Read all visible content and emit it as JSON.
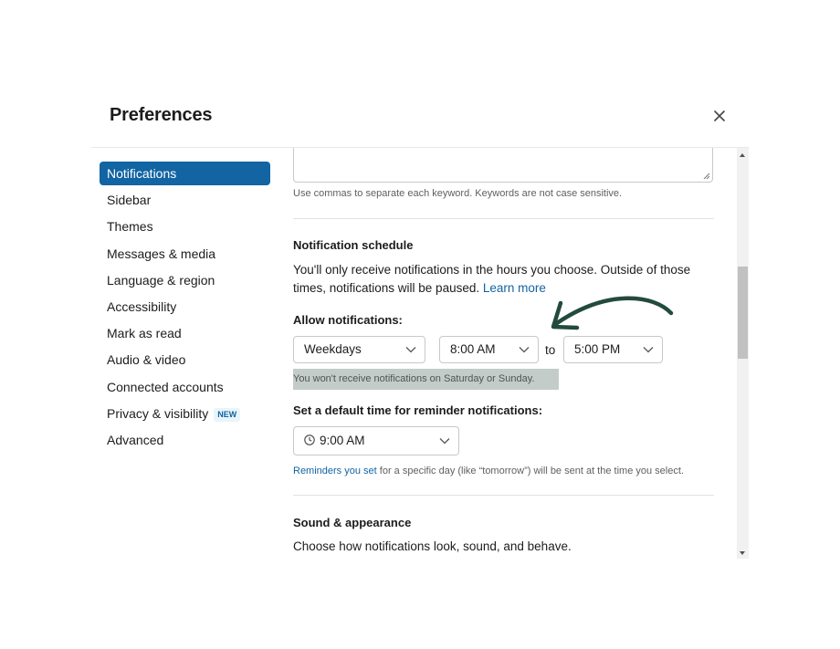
{
  "dialog": {
    "title": "Preferences",
    "close_icon": "close-icon"
  },
  "sidebar": {
    "items": [
      {
        "label": "Notifications",
        "active": true
      },
      {
        "label": "Sidebar"
      },
      {
        "label": "Themes"
      },
      {
        "label": "Messages & media"
      },
      {
        "label": "Language & region"
      },
      {
        "label": "Accessibility"
      },
      {
        "label": "Mark as read"
      },
      {
        "label": "Audio & video"
      },
      {
        "label": "Connected accounts"
      },
      {
        "label": "Privacy & visibility",
        "badge": "NEW"
      },
      {
        "label": "Advanced"
      }
    ]
  },
  "keywords": {
    "value": "",
    "hint": "Use commas to separate each keyword. Keywords are not case sensitive."
  },
  "schedule": {
    "heading": "Notification schedule",
    "description": "You'll only receive notifications in the hours you choose. Outside of those times, notifications will be paused.",
    "learn_more": "Learn more",
    "allow_label": "Allow notifications:",
    "days_value": "Weekdays",
    "from_value": "8:00 AM",
    "to_label": "to",
    "to_value": "5:00 PM",
    "days_hint": "You won't receive notifications on Saturday or Sunday."
  },
  "reminders": {
    "heading": "Set a default time for reminder notifications:",
    "time_value": "9:00 AM",
    "hint_link": "Reminders you set",
    "hint_rest": " for a specific day (like “tomorrow”) will be sent at the time you select."
  },
  "sound": {
    "heading": "Sound & appearance",
    "description": "Choose how notifications look, sound, and behave."
  },
  "colors": {
    "accent": "#1264a3",
    "annotation_arrow": "#234a3f",
    "highlight": "#c3ccc9"
  }
}
